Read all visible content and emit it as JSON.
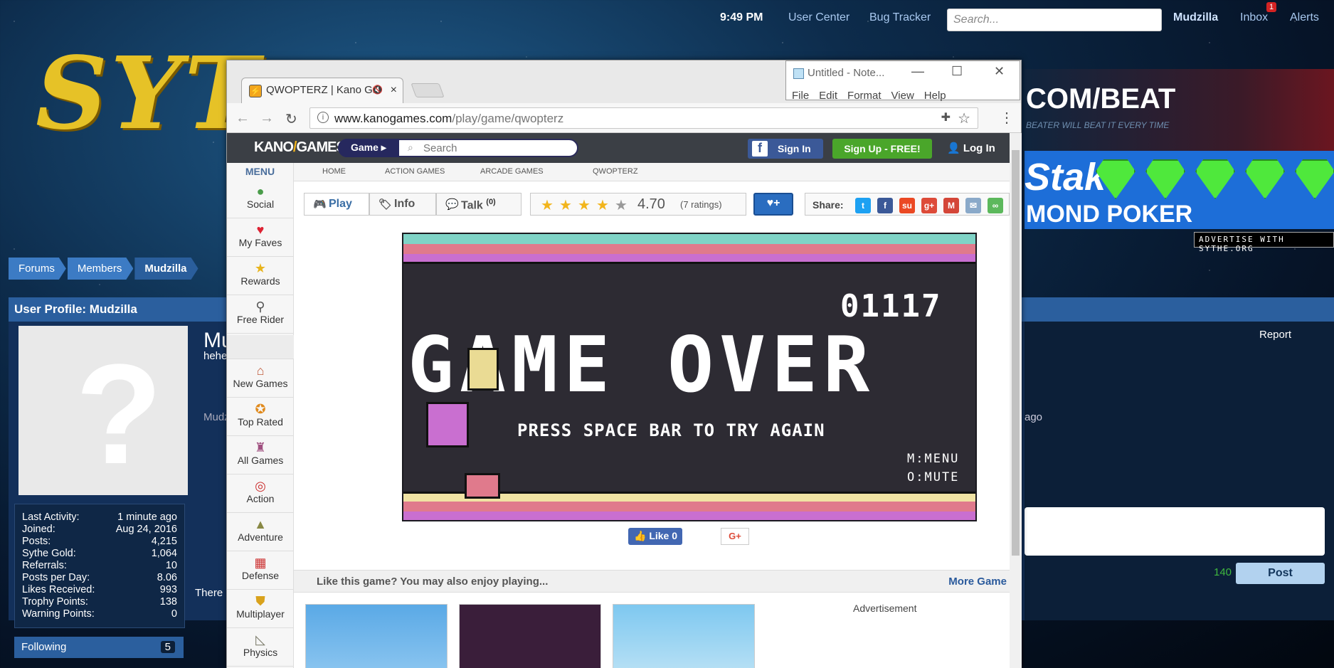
{
  "forum": {
    "time": "9:49 PM",
    "links": [
      "User Center",
      "Bug Tracker"
    ],
    "search_placeholder": "Search...",
    "username": "Mudzilla",
    "inbox": "Inbox",
    "inbox_count": "1",
    "alerts": "Alerts",
    "logo_text": "SYT",
    "breadcrumbs": [
      "Forums",
      "Members",
      "Mudzilla"
    ],
    "profile_title": "User Profile: Mudzilla",
    "profile_name": "Mu",
    "profile_sub": "hehe",
    "profile_sub2": "Mudz",
    "there_text": "There",
    "ago_text": "ago",
    "report": "Report",
    "stats": [
      {
        "label": "Last Activity:",
        "value": "1 minute ago"
      },
      {
        "label": "Joined:",
        "value": "Aug 24, 2016"
      },
      {
        "label": "Posts:",
        "value": "4,215"
      },
      {
        "label": "Sythe Gold:",
        "value": "1,064"
      },
      {
        "label": "Referrals:",
        "value": "10"
      },
      {
        "label": "Posts per Day:",
        "value": "8.06"
      },
      {
        "label": "Likes Received:",
        "value": "993"
      },
      {
        "label": "Trophy Points:",
        "value": "138"
      },
      {
        "label": "Warning Points:",
        "value": "0"
      }
    ],
    "following": "Following",
    "following_count": "5",
    "char_count": "140",
    "post_button": "Post",
    "ad_top_1": "COM/BEAT",
    "ad_top_2": "BEATER WILL BEAT IT EVERY TIME",
    "ad_stake_logo": "Stake",
    "ad_stake_text": "MOND POKER",
    "advertise": "ADVERTISE WITH SYTHE.ORG"
  },
  "notepad": {
    "title": "Untitled - Note...",
    "menu": [
      "File",
      "Edit",
      "Format",
      "View",
      "Help"
    ]
  },
  "browser": {
    "tab_title": "QWOPTERZ | Kano Ga",
    "url_host": "www.kanogames.com",
    "url_path": "/play/game/qwopterz"
  },
  "kano": {
    "logo_a": "KANO",
    "logo_b": "GAMES",
    "game_pill": "Game",
    "search_placeholder": "Search",
    "sign_in": "Sign In",
    "sign_up": "Sign Up - FREE!",
    "log_in": "Log In",
    "menu_title": "MENU",
    "menu": [
      {
        "label": "Social",
        "icon": "social-icon",
        "glyph": "●"
      },
      {
        "label": "My Faves",
        "icon": "heart-icon",
        "glyph": "♥"
      },
      {
        "label": "Rewards",
        "icon": "star-icon",
        "glyph": "★"
      },
      {
        "label": "Free Rider",
        "icon": "bike-icon",
        "glyph": "⚲"
      },
      {
        "label": "New Games",
        "icon": "house-icon",
        "glyph": "⌂"
      },
      {
        "label": "Top Rated",
        "icon": "medal-icon",
        "glyph": "✪"
      },
      {
        "label": "All Games",
        "icon": "joystick-icon",
        "glyph": "♜"
      },
      {
        "label": "Action",
        "icon": "target-icon",
        "glyph": "◎"
      },
      {
        "label": "Adventure",
        "icon": "rocket-icon",
        "glyph": "▲"
      },
      {
        "label": "Defense",
        "icon": "wall-icon",
        "glyph": "▦"
      },
      {
        "label": "Multiplayer",
        "icon": "shield-icon",
        "glyph": "⛊"
      },
      {
        "label": "Physics",
        "icon": "ruler-icon",
        "glyph": "◺"
      }
    ],
    "crumbs": [
      "HOME",
      "ACTION GAMES",
      "ARCADE GAMES",
      "QWOPTERZ"
    ],
    "tabs": [
      {
        "label": "Play",
        "icon": "gamepad-icon"
      },
      {
        "label": "Info",
        "icon": "tag-icon"
      },
      {
        "label": "Talk",
        "icon": "chat-icon"
      }
    ],
    "talk_count": "(0)",
    "rating_value": "4.70",
    "rating_stars": 4.7,
    "rating_count": "(7 ratings)",
    "fav_button": "♥+",
    "share_label": "Share:",
    "share_icons": [
      {
        "name": "twitter-icon",
        "glyph": "t",
        "color": "#1da1f2"
      },
      {
        "name": "facebook-icon",
        "glyph": "f",
        "color": "#3b5998"
      },
      {
        "name": "stumbleupon-icon",
        "glyph": "su",
        "color": "#eb4924"
      },
      {
        "name": "google-plus-icon",
        "glyph": "g+",
        "color": "#dd4b39"
      },
      {
        "name": "gmail-icon",
        "glyph": "M",
        "color": "#d44638"
      },
      {
        "name": "email-icon",
        "glyph": "✉",
        "color": "#8aa9c9"
      },
      {
        "name": "link-icon",
        "glyph": "∞",
        "color": "#5cb85c"
      }
    ],
    "game": {
      "score": "01117",
      "over_text": "GAME OVER",
      "press_text": "PRESS SPACE BAR TO TRY AGAIN",
      "menu_hint": "M:MENU",
      "mute_hint": "O:MUTE"
    },
    "like_label": "Like 0",
    "gplus_label": "G+",
    "also_title": "Like this game? You may also enjoy playing...",
    "more_games": "More Game",
    "advertisement": "Advertisement"
  }
}
